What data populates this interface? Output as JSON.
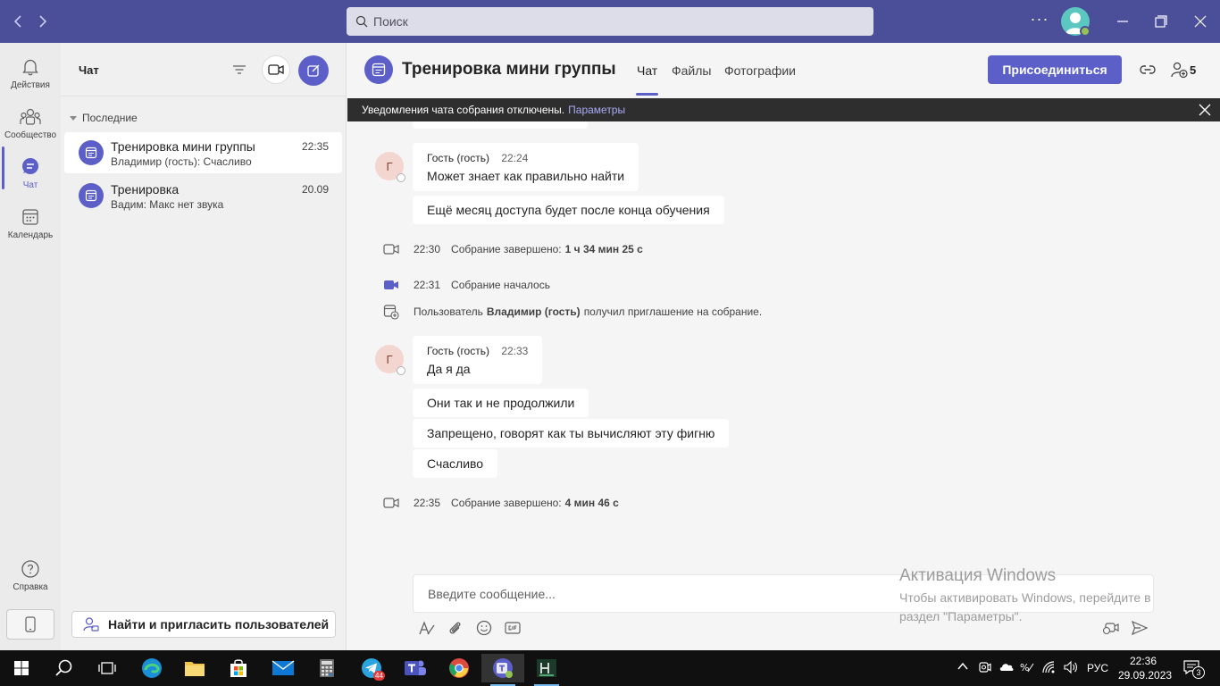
{
  "titlebar": {
    "search_placeholder": "Поиск",
    "more_label": "···"
  },
  "rail": {
    "activity": "Действия",
    "community": "Сообщество",
    "chat": "Чат",
    "calendar": "Календарь",
    "help": "Справка"
  },
  "chat_list": {
    "title": "Чат",
    "section": "Последние",
    "items": [
      {
        "title": "Тренировка мини группы",
        "subtitle": "Владимир (гость): Счасливо",
        "time": "22:35"
      },
      {
        "title": "Тренировка",
        "subtitle": "Вадим: Макс нет звука",
        "time": "20.09"
      }
    ],
    "invite_label": "Найти и пригласить пользователей"
  },
  "conversation": {
    "title": "Тренировка мини группы",
    "tabs": [
      "Чат",
      "Файлы",
      "Фотографии"
    ],
    "join_label": "Присоединиться",
    "participants_count": "5",
    "banner_text": "Уведомления чата собрания отключены.",
    "banner_link": "Параметры",
    "messages": [
      {
        "avatar": "Г",
        "sender": "Гость (гость)",
        "time": "22:24",
        "text": "Может знает как правильно найти"
      },
      {
        "text": "Ещё месяц доступа будет после конца обучения"
      }
    ],
    "sys1": {
      "time": "22:30",
      "text": "Собрание завершено:",
      "bold": "1 ч 34 мин 25 с"
    },
    "sys2": {
      "time": "22:31",
      "text": "Собрание началось"
    },
    "sys3": {
      "pre": "Пользователь",
      "bold": "Владимир (гость)",
      "post": "получил приглашение на собрание."
    },
    "messages2": [
      {
        "avatar": "Г",
        "sender": "Гость (гость)",
        "time": "22:33",
        "text": "Да я да"
      },
      {
        "text": "Они так и не продолжили"
      },
      {
        "text": "Запрещено, говорят как ты вычисляют эту фигню"
      },
      {
        "text": "Счасливо"
      }
    ],
    "sys4": {
      "time": "22:35",
      "text": "Собрание завершено:",
      "bold": "4 мин 46 с"
    },
    "composer_placeholder": "Введите сообщение..."
  },
  "watermark": {
    "title": "Активация Windows",
    "text": "Чтобы активировать Windows, перейдите в раздел \"Параметры\"."
  },
  "taskbar": {
    "telegram_badge": "44",
    "language": "РУС",
    "time": "22:36",
    "date": "29.09.2023",
    "notif_count": "3"
  },
  "colors": {
    "brand": "#5b5fc7",
    "titlebar": "#4b4f9a",
    "banner": "#2e2e2e"
  }
}
